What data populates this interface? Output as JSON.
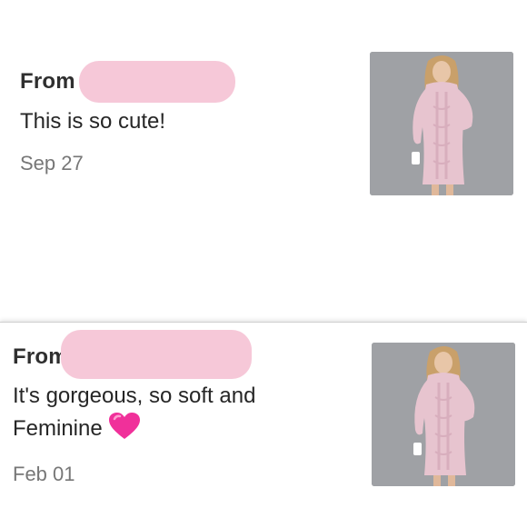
{
  "reviews": [
    {
      "from_label": "From",
      "comment": "This is so cute!",
      "date": "Sep 27"
    },
    {
      "from_label": "From",
      "comment": "It's gorgeous, so soft and Feminine",
      "date": "Feb 01",
      "emoji": "pink-heart-emoji"
    }
  ],
  "colors": {
    "name_redaction": "#f6c8d8",
    "heart": "#f0309a",
    "photo_background": "#9a9ca0",
    "dress": "#e7c4cf"
  }
}
